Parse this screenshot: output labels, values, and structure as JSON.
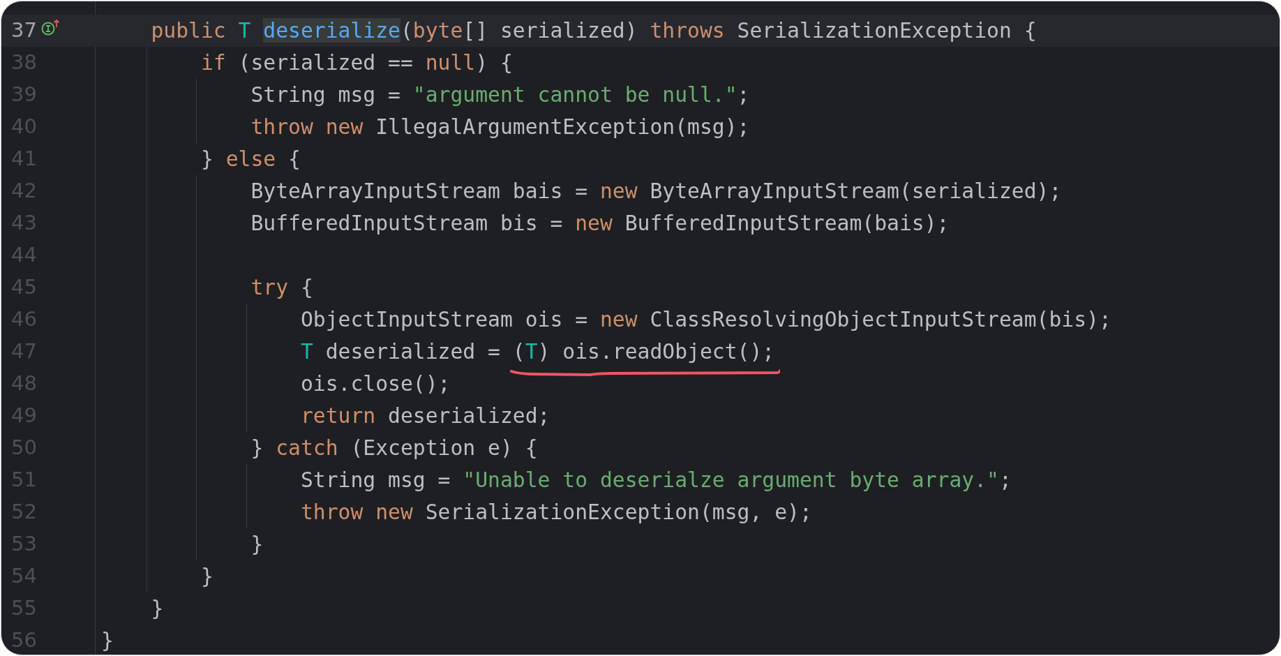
{
  "editor": {
    "lines": [
      {
        "number": "37",
        "current": true,
        "marker": true,
        "tokens": [
          {
            "text": "    public ",
            "kind": "keyword"
          },
          {
            "text": "T ",
            "kind": "type"
          },
          {
            "text": "deserialize",
            "kind": "method"
          },
          {
            "text": "(",
            "kind": "plain"
          },
          {
            "text": "byte",
            "kind": "keyword"
          },
          {
            "text": "[] serialized) ",
            "kind": "plain"
          },
          {
            "text": "throws ",
            "kind": "keyword"
          },
          {
            "text": "SerializationException {",
            "kind": "plain"
          }
        ]
      },
      {
        "number": "38",
        "current": false,
        "marker": false,
        "tokens": [
          {
            "text": "        if",
            "kind": "keyword"
          },
          {
            "text": " (serialized == ",
            "kind": "plain"
          },
          {
            "text": "null",
            "kind": "keyword"
          },
          {
            "text": ") {",
            "kind": "plain"
          }
        ]
      },
      {
        "number": "39",
        "current": false,
        "marker": false,
        "tokens": [
          {
            "text": "            String msg = ",
            "kind": "plain"
          },
          {
            "text": "\"argument cannot be null.\"",
            "kind": "string"
          },
          {
            "text": ";",
            "kind": "plain"
          }
        ]
      },
      {
        "number": "40",
        "current": false,
        "marker": false,
        "tokens": [
          {
            "text": "            throw new ",
            "kind": "keyword"
          },
          {
            "text": "IllegalArgumentException(msg);",
            "kind": "plain"
          }
        ]
      },
      {
        "number": "41",
        "current": false,
        "marker": false,
        "tokens": [
          {
            "text": "        } ",
            "kind": "plain"
          },
          {
            "text": "else",
            "kind": "keyword"
          },
          {
            "text": " {",
            "kind": "plain"
          }
        ]
      },
      {
        "number": "42",
        "current": false,
        "marker": false,
        "tokens": [
          {
            "text": "            ByteArrayInputStream bais = ",
            "kind": "plain"
          },
          {
            "text": "new ",
            "kind": "keyword"
          },
          {
            "text": "ByteArrayInputStream(serialized);",
            "kind": "plain"
          }
        ]
      },
      {
        "number": "43",
        "current": false,
        "marker": false,
        "tokens": [
          {
            "text": "            BufferedInputStream bis = ",
            "kind": "plain"
          },
          {
            "text": "new ",
            "kind": "keyword"
          },
          {
            "text": "BufferedInputStream(bais);",
            "kind": "plain"
          }
        ]
      },
      {
        "number": "44",
        "current": false,
        "marker": false
      },
      {
        "number": "45",
        "current": false,
        "marker": false,
        "tokens": [
          {
            "text": "            try",
            "kind": "keyword"
          },
          {
            "text": " {",
            "kind": "plain"
          }
        ]
      },
      {
        "number": "46",
        "current": false,
        "marker": false,
        "tokens": [
          {
            "text": "                ObjectInputStream ois = ",
            "kind": "plain"
          },
          {
            "text": "new ",
            "kind": "keyword"
          },
          {
            "text": "ClassResolvingObjectInputStream(bis);",
            "kind": "plain"
          }
        ]
      },
      {
        "number": "47",
        "current": false,
        "marker": false,
        "tokens": [
          {
            "text": "                T",
            "kind": "type"
          },
          {
            "text": " deserialized = ",
            "kind": "plain"
          },
          {
            "kind": "underline",
            "tokens": [
              {
                "text": "(",
                "kind": "plain"
              },
              {
                "text": "T",
                "kind": "type"
              },
              {
                "text": ") ois.readObject();",
                "kind": "plain"
              }
            ]
          }
        ]
      },
      {
        "number": "48",
        "current": false,
        "marker": false,
        "tokens": [
          {
            "text": "                ois.close();",
            "kind": "plain"
          }
        ]
      },
      {
        "number": "49",
        "current": false,
        "marker": false,
        "tokens": [
          {
            "text": "                return ",
            "kind": "keyword"
          },
          {
            "text": "deserialized;",
            "kind": "plain"
          }
        ]
      },
      {
        "number": "50",
        "current": false,
        "marker": false,
        "tokens": [
          {
            "text": "            } ",
            "kind": "plain"
          },
          {
            "text": "catch",
            "kind": "keyword"
          },
          {
            "text": " (Exception e) {",
            "kind": "plain"
          }
        ]
      },
      {
        "number": "51",
        "current": false,
        "marker": false,
        "tokens": [
          {
            "text": "                String msg = ",
            "kind": "plain"
          },
          {
            "text": "\"Unable to deserialze argument byte array.\"",
            "kind": "string"
          },
          {
            "text": ";",
            "kind": "plain"
          }
        ]
      },
      {
        "number": "52",
        "current": false,
        "marker": false,
        "tokens": [
          {
            "text": "                throw new ",
            "kind": "keyword"
          },
          {
            "text": "SerializationException(msg, e);",
            "kind": "plain"
          }
        ]
      },
      {
        "number": "53",
        "current": false,
        "marker": false,
        "tokens": [
          {
            "text": "            }",
            "kind": "plain"
          }
        ]
      },
      {
        "number": "54",
        "current": false,
        "marker": false,
        "tokens": [
          {
            "text": "        }",
            "kind": "plain"
          }
        ]
      },
      {
        "number": "55",
        "current": false,
        "marker": false,
        "tokens": [
          {
            "text": "    }",
            "kind": "plain"
          }
        ]
      },
      {
        "number": "56",
        "current": false,
        "marker": false,
        "tokens": [
          {
            "text": "}",
            "kind": "plain"
          }
        ]
      }
    ]
  }
}
